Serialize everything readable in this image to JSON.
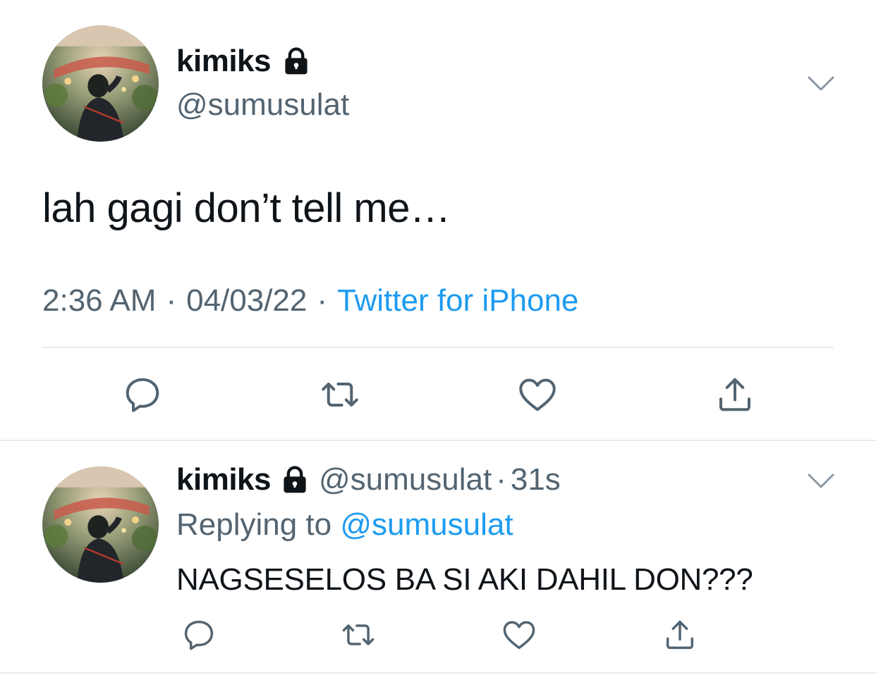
{
  "main_tweet": {
    "display_name": "kimiks",
    "handle": "@sumusulat",
    "text": "lah gagi don’t tell me…",
    "time": "2:36 AM",
    "sep": "·",
    "date": "04/03/22",
    "source": "Twitter for iPhone"
  },
  "reply_tweet": {
    "display_name": "kimiks",
    "handle": "@sumusulat",
    "sep": "·",
    "time_ago": "31s",
    "replying_prefix": "Replying to",
    "replying_to": "@sumusulat",
    "text": "NAGSESELOS BA SI AKI DAHIL DON???"
  },
  "icons": {
    "lock": "lock-icon",
    "caret": "chevron-down-icon",
    "reply": "reply-icon",
    "retweet": "retweet-icon",
    "like": "heart-icon",
    "share": "share-icon"
  },
  "colors": {
    "text": "#0f1419",
    "secondary": "#536471",
    "link": "#1d9bf0",
    "divider": "#e6ecf0"
  }
}
